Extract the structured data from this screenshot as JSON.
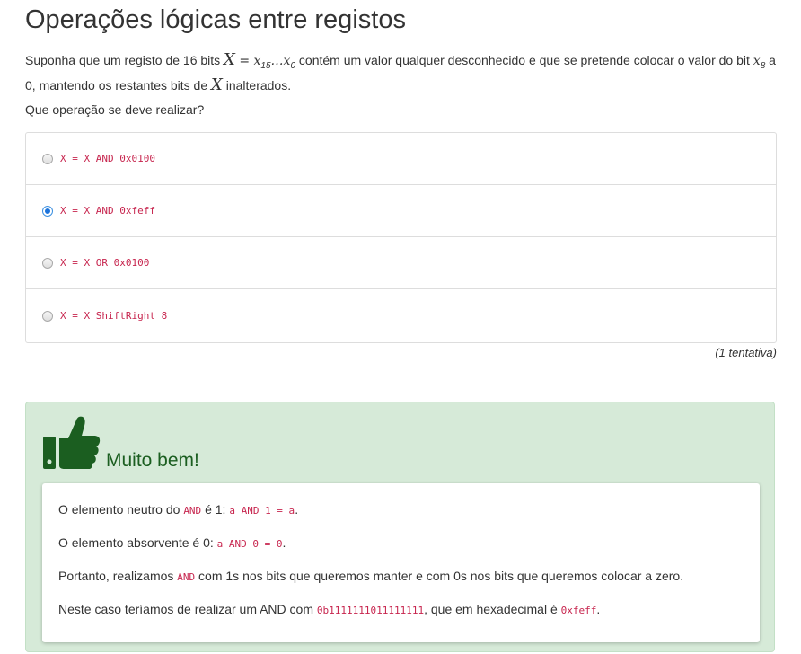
{
  "title": "Operações lógicas entre registos",
  "question": {
    "part1": "Suponha que um registo de 16 bits ",
    "math_X": "X",
    "math_eq": " = ",
    "math_x": "x",
    "math_15": "15",
    "math_dots": "…",
    "math_x0": "x",
    "math_0": "0",
    "part2": " contém um valor qualquer desconhecido e que se pretende colocar o valor do bit ",
    "math_x8": "x",
    "math_8": "8",
    "part3": " a 0, mantendo os restantes bits de ",
    "math_X2": "X",
    "part4": " inalterados."
  },
  "prompt": "Que operação se deve realizar?",
  "options": [
    {
      "label": "X = X AND 0x0100",
      "checked": false
    },
    {
      "label": "X = X AND 0xfeff",
      "checked": true
    },
    {
      "label": "X = X OR 0x0100",
      "checked": false
    },
    {
      "label": "X = X ShiftRight 8",
      "checked": false
    }
  ],
  "attempts": "(1 tentativa)",
  "feedback": {
    "icon": "thumbs-up-icon",
    "title": "Muito bem!",
    "p1_text": "O elemento neutro do ",
    "p1_code1": "AND",
    "p1_mid": " é 1: ",
    "p1_code2": "a AND 1 = a",
    "p1_end": ".",
    "p2_text": "O elemento absorvente é 0: ",
    "p2_code": "a AND 0 = 0",
    "p2_end": ".",
    "p3_text": "Portanto, realizamos ",
    "p3_code": "AND",
    "p3_end": " com 1s nos bits que queremos manter e com 0s nos bits que queremos colocar a zero.",
    "p4_text": "Neste caso teríamos de realizar um AND com ",
    "p4_code1": "0b1111111011111111",
    "p4_mid": ", que em hexadecimal é ",
    "p4_code2": "0xfeff",
    "p4_end": "."
  },
  "colors": {
    "code": "#c7254e",
    "feedback_bg": "#d6ead8",
    "thumb": "#1b5e20",
    "radio_checked": "#1c73db"
  }
}
